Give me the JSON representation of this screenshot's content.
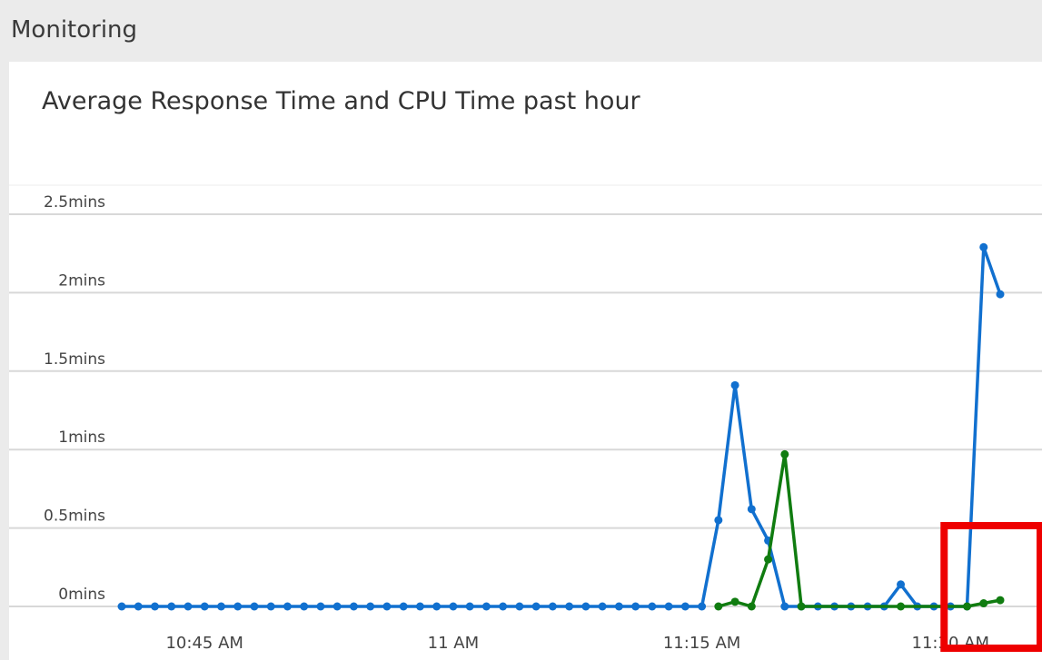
{
  "section": {
    "title": "Monitoring"
  },
  "chart_data": {
    "type": "line",
    "title": "Average Response Time and CPU Time past hour",
    "xlabel": "",
    "ylabel": "",
    "y_unit": "mins",
    "ylim": [
      0,
      2.5
    ],
    "y_ticks": [
      "0mins",
      "0.5mins",
      "1mins",
      "1.5mins",
      "2mins",
      "2.5mins"
    ],
    "x_ticks": [
      "10:45 AM",
      "11 AM",
      "11:15 AM",
      "11:30 AM"
    ],
    "grid": true,
    "series": [
      {
        "color": "#1170cf",
        "points": [
          [
            "10:40",
            0
          ],
          [
            "10:41",
            0
          ],
          [
            "10:42",
            0
          ],
          [
            "10:43",
            0
          ],
          [
            "10:44",
            0
          ],
          [
            "10:45",
            0
          ],
          [
            "10:46",
            0
          ],
          [
            "10:47",
            0
          ],
          [
            "10:48",
            0
          ],
          [
            "10:49",
            0
          ],
          [
            "10:50",
            0
          ],
          [
            "10:51",
            0
          ],
          [
            "10:52",
            0
          ],
          [
            "10:53",
            0
          ],
          [
            "10:54",
            0
          ],
          [
            "10:55",
            0
          ],
          [
            "10:56",
            0
          ],
          [
            "10:57",
            0
          ],
          [
            "10:58",
            0
          ],
          [
            "10:59",
            0
          ],
          [
            "11:00",
            0
          ],
          [
            "11:01",
            0
          ],
          [
            "11:02",
            0
          ],
          [
            "11:03",
            0
          ],
          [
            "11:04",
            0
          ],
          [
            "11:05",
            0
          ],
          [
            "11:06",
            0
          ],
          [
            "11:07",
            0
          ],
          [
            "11:08",
            0
          ],
          [
            "11:09",
            0
          ],
          [
            "11:10",
            0
          ],
          [
            "11:11",
            0
          ],
          [
            "11:12",
            0
          ],
          [
            "11:13",
            0
          ],
          [
            "11:14",
            0
          ],
          [
            "11:15",
            0
          ],
          [
            "11:16",
            0.55
          ],
          [
            "11:17",
            1.41
          ],
          [
            "11:18",
            0.62
          ],
          [
            "11:19",
            0.42
          ],
          [
            "11:20",
            0
          ],
          [
            "11:21",
            0
          ],
          [
            "11:22",
            0
          ],
          [
            "11:23",
            0
          ],
          [
            "11:24",
            0
          ],
          [
            "11:25",
            0
          ],
          [
            "11:26",
            0
          ],
          [
            "11:27",
            0.14
          ],
          [
            "11:28",
            0
          ],
          [
            "11:29",
            0
          ],
          [
            "11:30",
            0
          ],
          [
            "11:31",
            0
          ],
          [
            "11:32",
            2.29
          ],
          [
            "11:33",
            1.99
          ]
        ]
      },
      {
        "color": "#107c10",
        "points": [
          [
            "11:16",
            0
          ],
          [
            "11:17",
            0.03
          ],
          [
            "11:18",
            0
          ],
          [
            "11:19",
            0.3
          ],
          [
            "11:20",
            0.97
          ],
          [
            "11:21",
            0
          ],
          [
            "11:27",
            0
          ],
          [
            "11:31",
            0
          ],
          [
            "11:32",
            0.02
          ],
          [
            "11:33",
            0.04
          ]
        ]
      }
    ]
  },
  "highlight": {
    "color": "#ee0000",
    "x_range": [
      "11:30",
      "11:33"
    ]
  }
}
